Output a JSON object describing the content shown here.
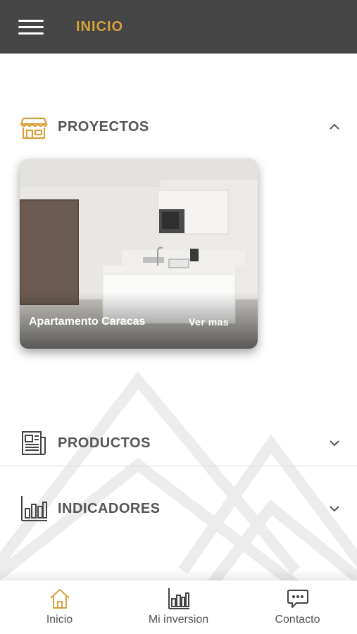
{
  "header": {
    "title": "INICIO",
    "menu_icon": "hamburger-menu-icon",
    "title_color": "#d6a23b",
    "bar_color": "#454545"
  },
  "sections": {
    "proyectos": {
      "label": "PROYECTOS",
      "icon": "storefront-icon",
      "expanded": true
    },
    "productos": {
      "label": "PRODUCTOS",
      "icon": "newspaper-icon",
      "expanded": false
    },
    "indicadores": {
      "label": "INDICADORES",
      "icon": "bar-chart-icon",
      "expanded": false
    }
  },
  "project_card": {
    "title": "Apartamento Caracas",
    "link_label": "Ver mas"
  },
  "bottom_nav": {
    "tabs": [
      {
        "label": "Inicio",
        "icon": "home-icon",
        "active": true
      },
      {
        "label": "Mi inversion",
        "icon": "bar-chart-icon",
        "active": false
      },
      {
        "label": "Contacto",
        "icon": "chat-bubble-icon",
        "active": false
      }
    ]
  },
  "colors": {
    "accent": "#d6a23b",
    "text": "#555555"
  }
}
